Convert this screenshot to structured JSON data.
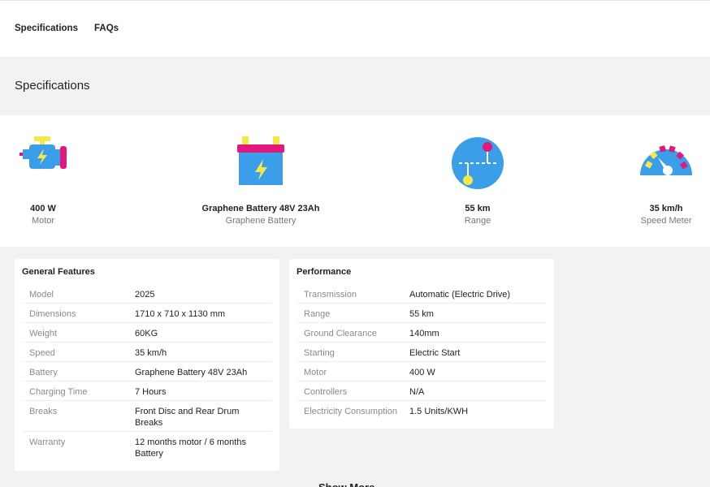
{
  "nav": {
    "tabs": [
      {
        "label": "Specifications"
      },
      {
        "label": "FAQs"
      }
    ]
  },
  "section": {
    "title": "Specifications"
  },
  "highlights": [
    {
      "value": "400 W",
      "label": "Motor",
      "icon": "motor-icon"
    },
    {
      "value": "Graphene Battery 48V 23Ah",
      "label": "Graphene Battery",
      "icon": "battery-icon"
    },
    {
      "value": "55 km",
      "label": "Range",
      "icon": "range-icon"
    },
    {
      "value": "35 km/h",
      "label": "Speed Meter",
      "icon": "speedometer-icon"
    }
  ],
  "general": {
    "title": "General Features",
    "rows": [
      {
        "k": "Model",
        "v": "2025"
      },
      {
        "k": "Dimensions",
        "v": "1710 x 710 x 1130 mm"
      },
      {
        "k": "Weight",
        "v": "60KG"
      },
      {
        "k": "Speed",
        "v": "35 km/h"
      },
      {
        "k": "Battery",
        "v": "Graphene Battery 48V 23Ah"
      },
      {
        "k": "Charging Time",
        "v": "7 Hours"
      },
      {
        "k": "Breaks",
        "v": "Front Disc and Rear Drum Breaks"
      },
      {
        "k": "Warranty",
        "v": "12 months motor / 6 months Battery"
      }
    ]
  },
  "performance": {
    "title": "Performance",
    "rows": [
      {
        "k": "Transmission",
        "v": "Automatic (Electric Drive)"
      },
      {
        "k": "Range",
        "v": "55 km"
      },
      {
        "k": "Ground Clearance",
        "v": "140mm"
      },
      {
        "k": "Starting",
        "v": "Electric Start"
      },
      {
        "k": "Motor",
        "v": "400 W"
      },
      {
        "k": "Controllers",
        "v": "N/A"
      },
      {
        "k": "Electricity Consumption",
        "v": "1.5 Units/KWH"
      }
    ]
  },
  "footer": {
    "partial_heading": "Show More"
  },
  "colors": {
    "accent_blue": "#3a9ee8",
    "accent_pink": "#e0197d",
    "accent_yellow": "#f6e74a"
  }
}
